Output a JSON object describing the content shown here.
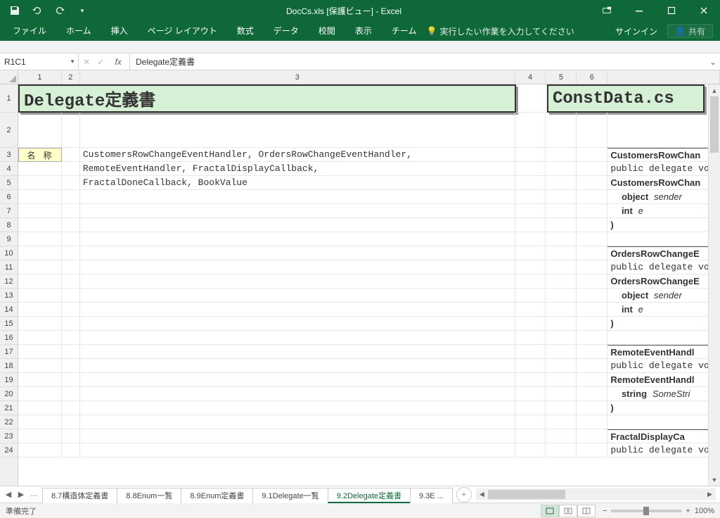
{
  "window": {
    "title": "DocCs.xls [保護ビュー] - Excel"
  },
  "ribbon": {
    "tabs": [
      "ファイル",
      "ホーム",
      "挿入",
      "ページ レイアウト",
      "数式",
      "データ",
      "校閲",
      "表示",
      "チーム"
    ],
    "tellme": "実行したい作業を入力してください",
    "signin": "サインイン",
    "share": "共有"
  },
  "namebox": "R1C1",
  "formula": "Delegate定義書",
  "columns": [
    "1",
    "2",
    "3",
    "4",
    "5",
    "6"
  ],
  "rows": [
    "1",
    "2",
    "3",
    "4",
    "5",
    "6",
    "7",
    "8",
    "9",
    "10",
    "11",
    "12",
    "13",
    "14",
    "15",
    "16",
    "17",
    "18",
    "19",
    "20",
    "21",
    "22",
    "23",
    "24"
  ],
  "cells": {
    "title_left": "Delegate定義書",
    "title_right": "ConstData.cs",
    "label": "名 称",
    "line3": "CustomersRowChangeEventHandler, OrdersRowChangeEventHandler,",
    "line4": "RemoteEventHandler, FractalDisplayCallback,",
    "line5": "FractalDoneCallback, BookValue",
    "r3r": "CustomersRowChan",
    "r4r": "public delegate vo",
    "r5r": "CustomersRowChan",
    "r6r_a": "object",
    "r6r_b": "sender",
    "r7r_a": "int",
    "r7r_b": "e",
    "r8r": ")",
    "r10r": "OrdersRowChangeE",
    "r11r": "public delegate vo",
    "r12r": "OrdersRowChangeE",
    "r13r_a": "object",
    "r13r_b": "sender",
    "r14r_a": "int",
    "r14r_b": "e",
    "r15r": ")",
    "r17r": "RemoteEventHandl",
    "r18r": "public delegate vo",
    "r19r": "RemoteEventHandl",
    "r20r_a": "string",
    "r20r_b": "SomeStri",
    "r21r": ")",
    "r23r": "FractalDisplayCa",
    "r24r": "public delegate vo"
  },
  "sheet_tabs": {
    "list": [
      "8.7構造体定義書",
      "8.8Enum一覧",
      "8.9Enum定義書",
      "9.1Delegate一覧",
      "9.2Delegate定義書",
      "9.3E"
    ],
    "active_index": 4,
    "more": "..."
  },
  "status": {
    "ready": "準備完了",
    "zoom": "100%"
  }
}
